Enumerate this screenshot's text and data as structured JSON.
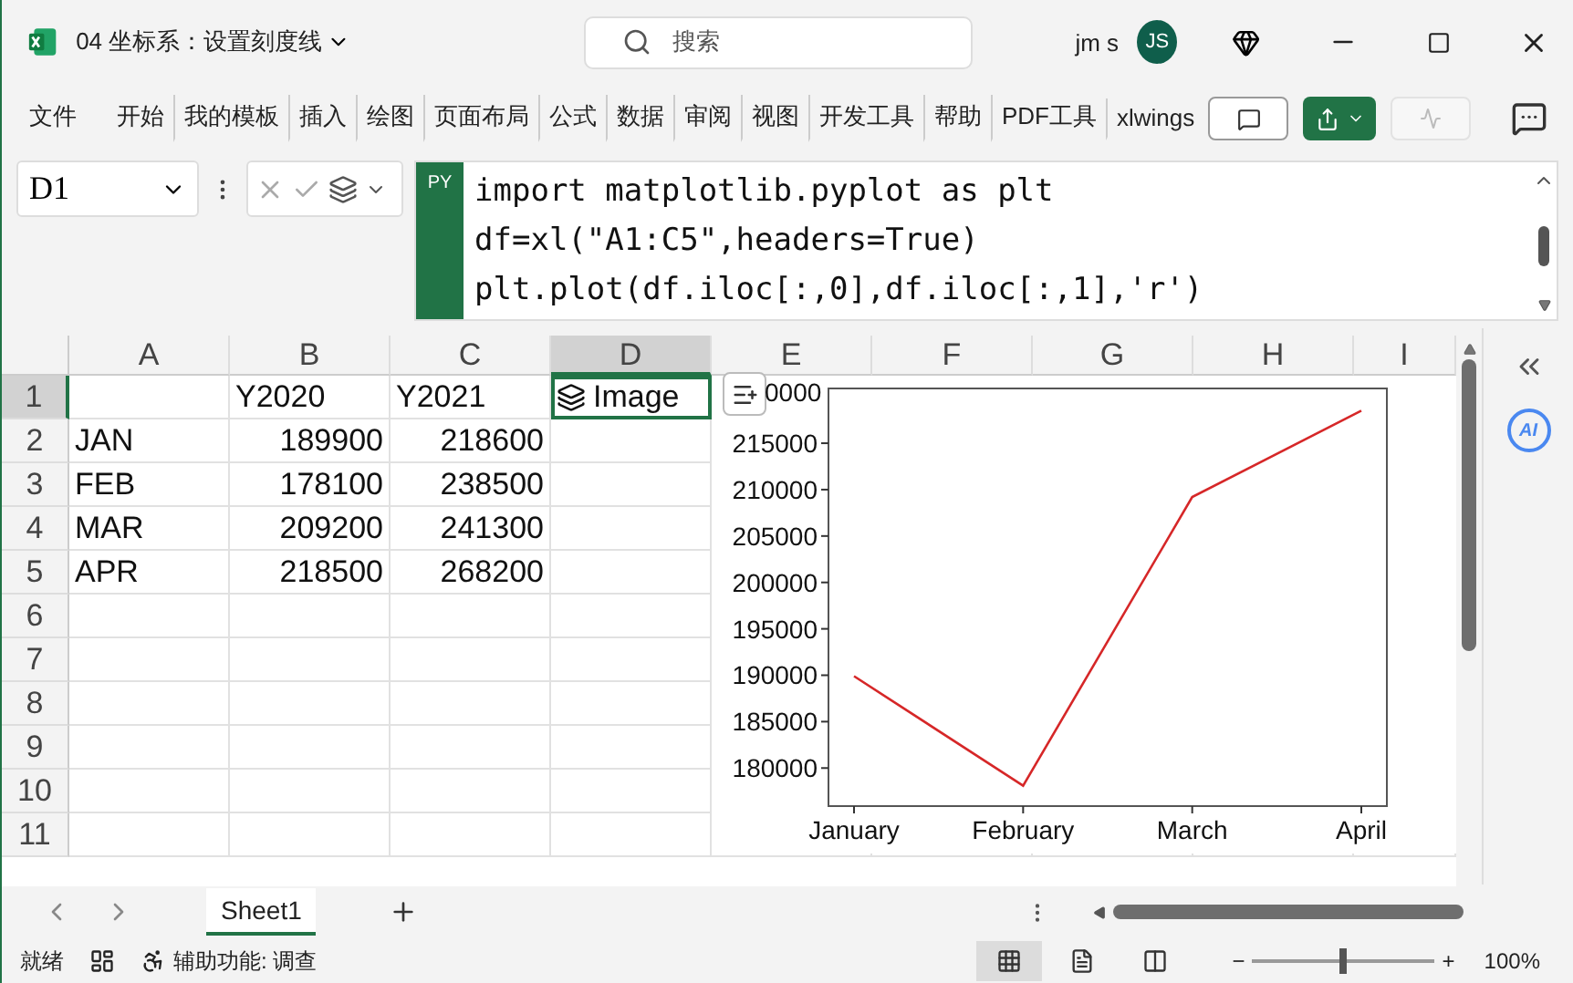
{
  "window": {
    "title": "04 坐标系：设置刻度线",
    "search_placeholder": "搜索",
    "user": "jm s",
    "avatar": "JS"
  },
  "ribbon": {
    "tabs": [
      {
        "label": "文件",
        "selected": false
      },
      {
        "label": "开始",
        "selected": false
      },
      {
        "label": "我的模板",
        "selected": false
      },
      {
        "label": "插入",
        "selected": false
      },
      {
        "label": "绘图",
        "selected": false
      },
      {
        "label": "页面布局",
        "selected": false
      },
      {
        "label": "公式",
        "selected": false
      },
      {
        "label": "数据",
        "selected": false
      },
      {
        "label": "审阅",
        "selected": false
      },
      {
        "label": "视图",
        "selected": false
      },
      {
        "label": "开发工具",
        "selected": false
      },
      {
        "label": "帮助",
        "selected": false
      },
      {
        "label": "PDF工具",
        "selected": false
      },
      {
        "label": "xlwings",
        "selected": false
      }
    ]
  },
  "formula_bar": {
    "name_box": "D1",
    "badge": "PY",
    "code": [
      "import matplotlib.pyplot as plt",
      "df=xl(\"A1:C5\",headers=True)",
      "plt.plot(df.iloc[:,0],df.iloc[:,1],'r')"
    ]
  },
  "sheet": {
    "columns": [
      {
        "label": "A",
        "selected": false
      },
      {
        "label": "B",
        "selected": false
      },
      {
        "label": "C",
        "selected": false
      },
      {
        "label": "D",
        "selected": true
      },
      {
        "label": "E",
        "selected": false
      },
      {
        "label": "F",
        "selected": false
      },
      {
        "label": "G",
        "selected": false
      },
      {
        "label": "H",
        "selected": false
      },
      {
        "label": "I",
        "selected": false
      }
    ],
    "rows": [
      {
        "label": "1",
        "selected": true,
        "cells": [
          {
            "text": ""
          },
          {
            "text": "Y2020",
            "kind": "text"
          },
          {
            "text": "Y2021",
            "kind": "text"
          },
          {
            "text": "Image",
            "kind": "image"
          }
        ]
      },
      {
        "label": "2",
        "selected": false,
        "cells": [
          {
            "text": "JAN",
            "kind": "text"
          },
          {
            "text": "189900",
            "kind": "number"
          },
          {
            "text": "218600",
            "kind": "number"
          }
        ]
      },
      {
        "label": "3",
        "selected": false,
        "cells": [
          {
            "text": "FEB",
            "kind": "text"
          },
          {
            "text": "178100",
            "kind": "number"
          },
          {
            "text": "238500",
            "kind": "number"
          }
        ]
      },
      {
        "label": "4",
        "selected": false,
        "cells": [
          {
            "text": "MAR",
            "kind": "text"
          },
          {
            "text": "209200",
            "kind": "number"
          },
          {
            "text": "241300",
            "kind": "number"
          }
        ]
      },
      {
        "label": "5",
        "selected": false,
        "cells": [
          {
            "text": "APR",
            "kind": "text"
          },
          {
            "text": "218500",
            "kind": "number"
          },
          {
            "text": "268200",
            "kind": "number"
          }
        ]
      },
      {
        "label": "6",
        "selected": false,
        "cells": []
      },
      {
        "label": "7",
        "selected": false,
        "cells": []
      },
      {
        "label": "8",
        "selected": false,
        "cells": []
      },
      {
        "label": "9",
        "selected": false,
        "cells": []
      },
      {
        "label": "10",
        "selected": false,
        "cells": []
      },
      {
        "label": "11",
        "selected": false,
        "cells": []
      }
    ],
    "chart_data": {
      "type": "line",
      "categories": [
        "January",
        "February",
        "March",
        "April"
      ],
      "series": [
        {
          "color": "#d62728",
          "values": [
            189900,
            178100,
            209200,
            218500
          ]
        }
      ],
      "ylim": [
        175900,
        220900
      ],
      "yticks": [
        180000,
        185000,
        190000,
        195000,
        200000,
        205000,
        210000,
        215000
      ]
    },
    "chart_cut_label": "0000"
  },
  "side_panel": {
    "ai_label": "AI"
  },
  "sheet_tabs": [
    {
      "label": "Sheet1",
      "selected": true
    }
  ],
  "status_bar": {
    "ready": "就绪",
    "accessibility": "辅助功能: 调查",
    "views": [
      {
        "kind": "normal",
        "selected": true
      },
      {
        "kind": "page_layout",
        "selected": false
      },
      {
        "kind": "page_break",
        "selected": false
      }
    ],
    "zoom_slider": {
      "level": 0.5
    },
    "zoom_out": "−",
    "zoom_in": "+",
    "zoom": "100%"
  }
}
